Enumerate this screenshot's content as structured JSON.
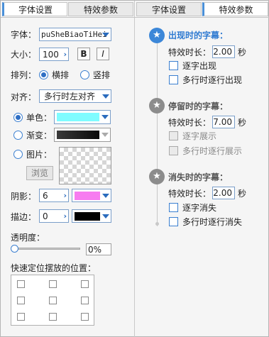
{
  "tabs": {
    "left": [
      {
        "label": "字体设置",
        "active": true
      },
      {
        "label": "特效参数",
        "active": false
      }
    ],
    "right": [
      {
        "label": "字体设置",
        "active": false
      },
      {
        "label": "特效参数",
        "active": true
      }
    ]
  },
  "font_panel": {
    "font_label": "字体：",
    "font_value": "puSheBiaoTiHei",
    "size_label": "大小：",
    "size_value": "100",
    "bold_label": "B",
    "italic_label": "I",
    "arrange_label": "排列：",
    "arrange_options": [
      {
        "label": "横排",
        "selected": true
      },
      {
        "label": "竖排",
        "selected": false
      }
    ],
    "align_label": "对齐：",
    "align_value": "多行时左对齐",
    "solid_label": "单色：",
    "solid_selected": true,
    "solid_color": "#7ffcff",
    "gradient_label": "渐变：",
    "gradient_colors": [
      "#3a3a3a",
      "#0a0a0a"
    ],
    "image_label": "图片：",
    "browse_label": "浏览",
    "shadow_label": "阴影：",
    "shadow_value": "6",
    "shadow_color": "#f77cf0",
    "stroke_label": "描边：",
    "stroke_value": "0",
    "stroke_color": "#000000",
    "opacity_label": "透明度：",
    "opacity_value": "0%",
    "position_label": "快速定位摆放的位置："
  },
  "effects_panel": {
    "appear": {
      "title": "出现时的字幕：",
      "duration_label": "特效时长：",
      "duration_value": "2.00",
      "unit": "秒",
      "options": [
        {
          "label": "逐字出现",
          "enabled": true,
          "checked": false
        },
        {
          "label": "多行时逐行出现",
          "enabled": true,
          "checked": false
        }
      ]
    },
    "stay": {
      "title": "停留时的字幕：",
      "duration_label": "特效时长：",
      "duration_value": "7.00",
      "unit": "秒",
      "options": [
        {
          "label": "逐字展示",
          "enabled": false,
          "checked": false
        },
        {
          "label": "多行时逐行展示",
          "enabled": false,
          "checked": false
        }
      ]
    },
    "disappear": {
      "title": "消失时的字幕：",
      "duration_label": "特效时长：",
      "duration_value": "2.00",
      "unit": "秒",
      "options": [
        {
          "label": "逐字消失",
          "enabled": true,
          "checked": false
        },
        {
          "label": "多行时逐行消失",
          "enabled": true,
          "checked": false
        }
      ]
    }
  },
  "icons": {
    "appear": "star-in-icon",
    "stay": "star-icon",
    "disappear": "star-out-icon"
  },
  "colors": {
    "accent": "#2e7ad1",
    "appear_icon": "#3c87d8",
    "stay_icon": "#8c8c8c",
    "disappear_icon": "#8c8c8c"
  }
}
